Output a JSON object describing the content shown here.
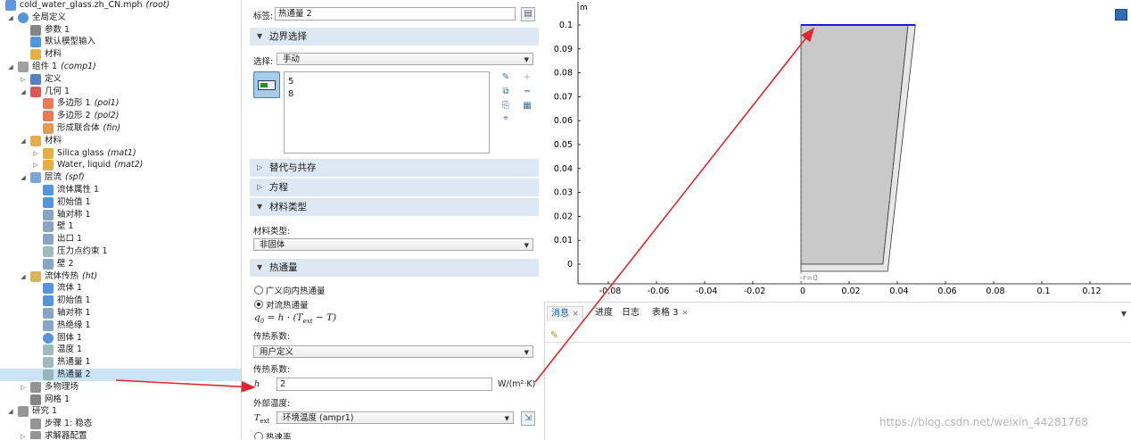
{
  "tree": {
    "items": [
      {
        "text": "cold_water_glass.zh_CN.mph",
        "tag": "(root)",
        "icon": "model-icon",
        "toggle": "",
        "level": 0
      },
      {
        "text": "全局定义",
        "tag": "",
        "icon": "globe-icon",
        "toggle": "open",
        "level": 1
      },
      {
        "text": "参数 1",
        "tag": "",
        "icon": "parameter-icon",
        "toggle": "",
        "level": 2
      },
      {
        "text": "默认模型输入",
        "tag": "",
        "icon": "model-input-icon",
        "toggle": "",
        "level": 2
      },
      {
        "text": "材料",
        "tag": "",
        "icon": "material-icon",
        "toggle": "",
        "level": 2
      },
      {
        "text": "组件 1",
        "tag": "(comp1)",
        "icon": "component-icon",
        "toggle": "open",
        "level": 1
      },
      {
        "text": "定义",
        "tag": "",
        "icon": "definitions-icon",
        "toggle": "closed",
        "level": 2
      },
      {
        "text": "几何 1",
        "tag": "",
        "icon": "geometry-icon",
        "toggle": "open",
        "level": 2
      },
      {
        "text": "多边形 1",
        "tag": "(pol1)",
        "icon": "polygon-icon",
        "toggle": "",
        "level": 3
      },
      {
        "text": "多边形 2",
        "tag": "(pol2)",
        "icon": "polygon-icon",
        "toggle": "",
        "level": 3
      },
      {
        "text": "形成联合体",
        "tag": "(fin)",
        "icon": "form-union-icon",
        "toggle": "",
        "level": 3
      },
      {
        "text": "材料",
        "tag": "",
        "icon": "materials-icon",
        "toggle": "open",
        "level": 2
      },
      {
        "text": "Silica glass",
        "tag": "(mat1)",
        "icon": "material-icon",
        "toggle": "closed",
        "level": 3
      },
      {
        "text": "Water, liquid",
        "tag": "(mat2)",
        "icon": "material-icon",
        "toggle": "closed",
        "level": 3
      },
      {
        "text": "层流",
        "tag": "(spf)",
        "icon": "laminar-flow-icon",
        "toggle": "open",
        "level": 2
      },
      {
        "text": "流体属性 1",
        "tag": "",
        "icon": "fluid-properties-icon",
        "toggle": "",
        "level": 3
      },
      {
        "text": "初始值 1",
        "tag": "",
        "icon": "initial-values-icon",
        "toggle": "",
        "level": 3
      },
      {
        "text": "轴对称 1",
        "tag": "",
        "icon": "axial-symmetry-icon",
        "toggle": "",
        "level": 3
      },
      {
        "text": "壁 1",
        "tag": "",
        "icon": "wall-icon",
        "toggle": "",
        "level": 3
      },
      {
        "text": "出口 1",
        "tag": "",
        "icon": "outlet-icon",
        "toggle": "",
        "level": 3
      },
      {
        "text": "压力点约束 1",
        "tag": "",
        "icon": "pressure-point-icon",
        "toggle": "",
        "level": 3
      },
      {
        "text": "壁 2",
        "tag": "",
        "icon": "wall-icon",
        "toggle": "",
        "level": 3
      },
      {
        "text": "流体传热",
        "tag": "(ht)",
        "icon": "heat-transfer-icon",
        "toggle": "open",
        "level": 2
      },
      {
        "text": "流体 1",
        "tag": "",
        "icon": "fluid-icon",
        "toggle": "",
        "level": 3
      },
      {
        "text": "初始值 1",
        "tag": "",
        "icon": "initial-values-icon",
        "toggle": "",
        "level": 3
      },
      {
        "text": "轴对称 1",
        "tag": "",
        "icon": "axial-symmetry-icon",
        "toggle": "",
        "level": 3
      },
      {
        "text": "热绝缘 1",
        "tag": "",
        "icon": "thermal-insulation-icon",
        "toggle": "",
        "level": 3
      },
      {
        "text": "固体 1",
        "tag": "",
        "icon": "solid-icon",
        "toggle": "",
        "level": 3
      },
      {
        "text": "温度 1",
        "tag": "",
        "icon": "temperature-icon",
        "toggle": "",
        "level": 3
      },
      {
        "text": "热通量 1",
        "tag": "",
        "icon": "heat-flux-icon",
        "toggle": "",
        "level": 3
      },
      {
        "text": "热通量 2",
        "tag": "",
        "icon": "heat-flux-icon",
        "toggle": "",
        "level": 3,
        "selected": true
      },
      {
        "text": "多物理场",
        "tag": "",
        "icon": "multiphysics-icon",
        "toggle": "closed",
        "level": 2
      },
      {
        "text": "网格 1",
        "tag": "",
        "icon": "mesh-icon",
        "toggle": "",
        "level": 2
      },
      {
        "text": "研究 1",
        "tag": "",
        "icon": "study-icon",
        "toggle": "open",
        "level": 1
      },
      {
        "text": "步骤 1: 稳态",
        "tag": "",
        "icon": "stationary-step-icon",
        "toggle": "",
        "level": 2
      },
      {
        "text": "求解器配置",
        "tag": "",
        "icon": "solver-config-icon",
        "toggle": "closed",
        "level": 2
      }
    ]
  },
  "settings": {
    "label_caption": "标签:",
    "label_value": "热通量 2",
    "boundary_section": "边界选择",
    "selection_caption": "选择:",
    "selection_value": "手动",
    "boundaries": [
      "5",
      "8"
    ],
    "override_section": "替代与共存",
    "equation_section": "方程",
    "material_type_section": "材料类型",
    "material_type_caption": "材料类型:",
    "material_type_value": "非固体",
    "heat_flux_section": "热通量",
    "radio_general": "广义向内热通量",
    "radio_convective": "对流热通量",
    "formula_left": "q",
    "formula_sub": "0",
    "formula_mid": " = h · (T",
    "formula_sub2": "ext",
    "formula_right": " − T)",
    "coefficient_caption": "传热系数:",
    "coefficient_value": "用户定义",
    "coefficient_caption2": "传热系数:",
    "h_symbol": "h",
    "h_value": "2",
    "h_unit": "W/(m²·K)",
    "ext_temp_caption": "外部温度:",
    "text_symbol": "T",
    "text_sub": "ext",
    "ext_temp_value": "环境温度 (ampr1)",
    "radio_heat_rate": "热速率"
  },
  "graphics": {
    "axis_unit": "m",
    "r0_label": "r=0",
    "x_ticks": [
      "-0.08",
      "-0.06",
      "-0.04",
      "-0.02",
      "0",
      "0.02",
      "0.04",
      "0.06",
      "0.08",
      "0.1",
      "0.12"
    ],
    "y_ticks": [
      "0.1",
      "0.09",
      "0.08",
      "0.07",
      "0.06",
      "0.05",
      "0.04",
      "0.03",
      "0.02",
      "0.01",
      "0"
    ],
    "glass_color": "#c9c9c9",
    "highlight_color": "#1a1adc"
  },
  "messages": {
    "tabs": [
      "消息",
      "进度",
      "日志",
      "表格 3"
    ]
  },
  "annotation": {
    "arrow_color": "#e0252b"
  },
  "watermark": "https://blog.csdn.net/weixin_44281768"
}
